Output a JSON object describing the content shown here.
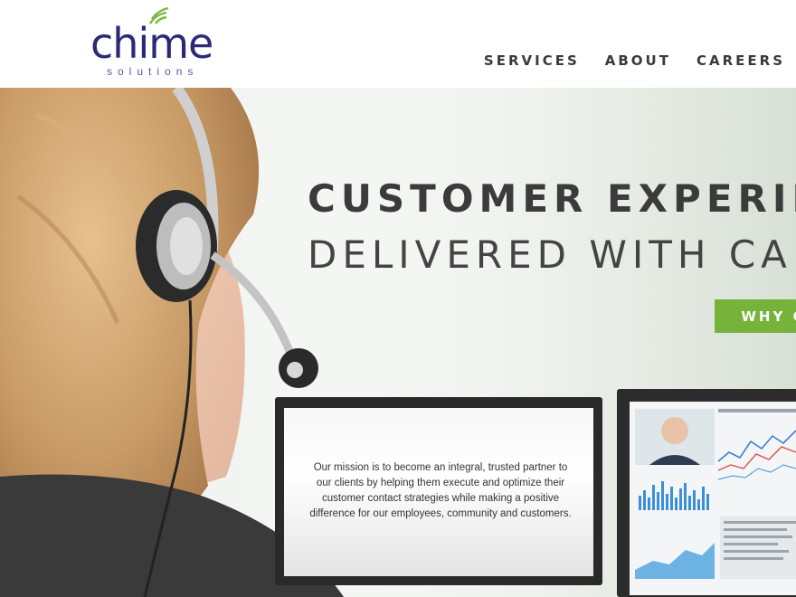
{
  "brand": {
    "logo_word": "chime",
    "logo_sub": "solutions"
  },
  "nav": {
    "items": [
      "SERVICES",
      "ABOUT",
      "CAREERS"
    ]
  },
  "hero": {
    "headline_line1": "CUSTOMER EXPERIE",
    "headline_line2": "DELIVERED WITH CA",
    "cta_label": "WHY C",
    "mission_text": "Our mission is to become an integral, trusted partner to our clients by helping them execute and optimize their customer contact strategies while making a positive difference for our employees, community and customers."
  },
  "colors": {
    "brand_navy": "#2b2a78",
    "accent_green": "#76b33b",
    "nav_text": "#3a3a3a"
  },
  "icons": {
    "logo_signal": "signal-waves-icon"
  }
}
